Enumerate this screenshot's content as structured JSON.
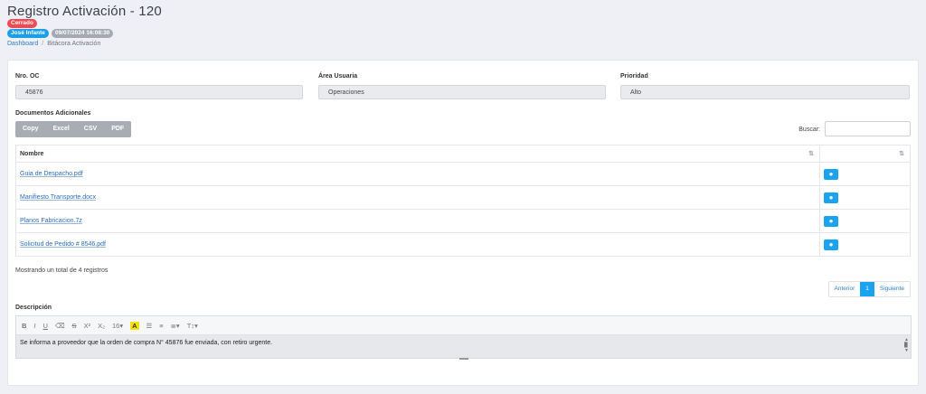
{
  "header": {
    "title": "Registro Activación - 120",
    "status_badge": "Cerrado",
    "user_badge": "José Infante",
    "date_badge": "09/07/2024 16:08:30",
    "breadcrumb": [
      "Dashboard",
      "Bitácora Activación"
    ]
  },
  "fields": {
    "oc_label": "Nro. OC",
    "oc_value": "45876",
    "area_label": "Área Usuaria",
    "area_value": "Operaciones",
    "prioridad_label": "Prioridad",
    "prioridad_value": "Alto"
  },
  "documents": {
    "section_label": "Documentos Adicionales",
    "buttons": [
      "Copy",
      "Excel",
      "CSV",
      "PDF"
    ],
    "search_label": "Buscar:",
    "column_name": "Nombre",
    "rows": [
      "Guia de Despacho.pdf",
      "Manifiesto Transporte.docx",
      "Planos Fabricacion.7z",
      "Solicitud de Pedido # 8546.pdf"
    ],
    "info": "Mostrando un total de 4 registros",
    "pager": {
      "prev": "Anterior",
      "current": "1",
      "next": "Siguiente"
    }
  },
  "description": {
    "label": "Descripción",
    "text": "Se informa a proveedor que la orden de compra N° 45876 fue enviada, con retiro urgente."
  },
  "colors": {
    "accent": "#1ba3ef",
    "status_red": "#f24a53",
    "link": "#2f6db5"
  }
}
